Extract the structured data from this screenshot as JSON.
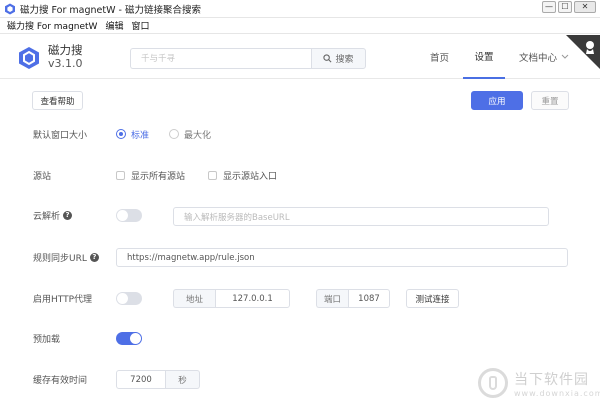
{
  "window": {
    "title": "磁力搜 For magnetW - 磁力链接聚合搜索",
    "minimize": "—",
    "maximize": "☐",
    "close": "✕"
  },
  "menubar": {
    "items": [
      "磁力搜 For magnetW",
      "编辑",
      "窗口"
    ]
  },
  "header": {
    "app_name": "磁力搜",
    "version": "v3.1.0",
    "search_placeholder": "千与千寻",
    "search_button": "搜索",
    "nav": {
      "home": "首页",
      "settings": "设置",
      "docs": "文档中心"
    },
    "accent_color": "#4e6fe6"
  },
  "toolbar": {
    "help": "查看帮助",
    "apply": "应用",
    "reset": "重置"
  },
  "settings": {
    "window_size": {
      "label": "默认窗口大小",
      "options": [
        "标准",
        "最大化"
      ],
      "selected": "标准"
    },
    "source": {
      "label": "源站",
      "show_all": "显示所有源站",
      "show_entry": "显示源站入口"
    },
    "cloud_parse": {
      "label": "云解析",
      "enabled": false,
      "placeholder": "输入解析服务器的BaseURL"
    },
    "rule_sync": {
      "label": "规则同步URL",
      "value": "https://magnetw.app/rule.json"
    },
    "http_proxy": {
      "label": "启用HTTP代理",
      "enabled": false,
      "address_label": "地址",
      "address": "127.0.0.1",
      "port_label": "端口",
      "port": "1087",
      "test_button": "测试连接"
    },
    "preload": {
      "label": "预加载",
      "enabled": true
    },
    "cache": {
      "label": "缓存有效时间",
      "value": "7200",
      "unit": "秒"
    }
  },
  "watermark": {
    "brand": "当下软件园",
    "url": "www.downxia.com"
  }
}
